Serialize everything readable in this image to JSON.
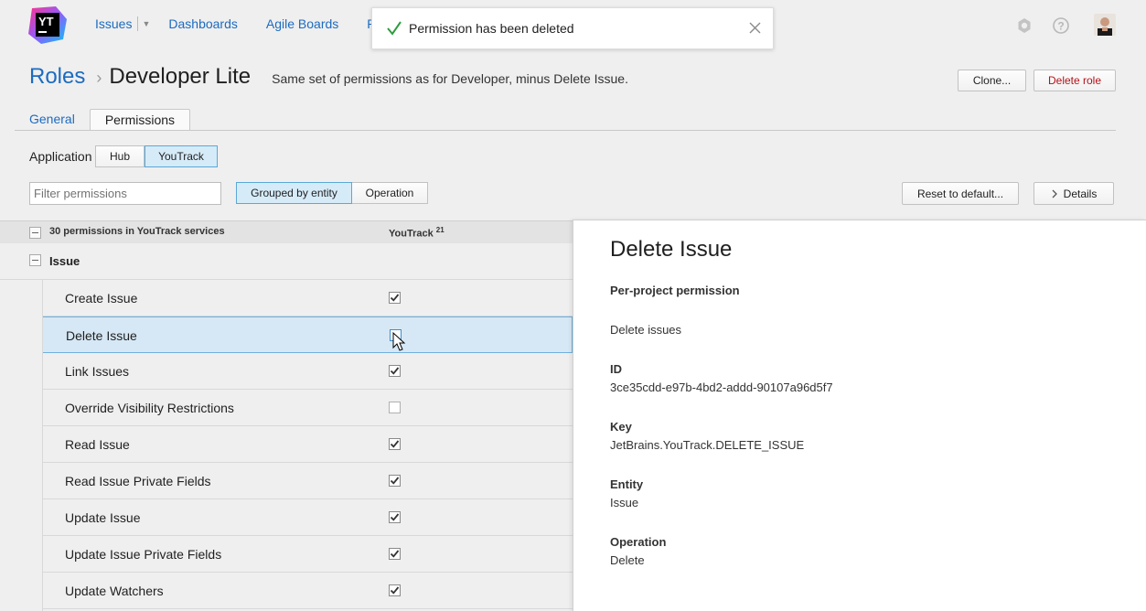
{
  "header": {
    "logo_text": "YT",
    "nav": {
      "issues": "Issues",
      "dashboards": "Dashboards",
      "agile_boards": "Agile Boards",
      "reports_truncated": "Re"
    }
  },
  "toast": {
    "message": "Permission has been deleted"
  },
  "page": {
    "breadcrumb_root": "Roles",
    "breadcrumb_sep": "›",
    "role_name": "Developer Lite",
    "role_description": "Same set of permissions as for Developer, minus Delete Issue.",
    "clone_label": "Clone...",
    "delete_role_label": "Delete role"
  },
  "tabs": [
    {
      "label": "General",
      "active": false
    },
    {
      "label": "Permissions",
      "active": true
    }
  ],
  "application": {
    "label": "Application",
    "options": [
      "Hub",
      "YouTrack"
    ],
    "selected": "YouTrack"
  },
  "filter": {
    "placeholder": "Filter permissions",
    "value": ""
  },
  "grouping": {
    "options": [
      "Grouped by entity",
      "Operation"
    ],
    "selected": "Grouped by entity"
  },
  "actions": {
    "reset_label": "Reset to default...",
    "details_label": "Details"
  },
  "table": {
    "header_title": "30 permissions in YouTrack services",
    "column": "YouTrack",
    "column_count": "21",
    "group": "Issue",
    "rows": [
      {
        "label": "Create Issue",
        "checked": true
      },
      {
        "label": "Delete Issue",
        "checked": false,
        "selected": true
      },
      {
        "label": "Link Issues",
        "checked": true
      },
      {
        "label": "Override Visibility Restrictions",
        "checked": false
      },
      {
        "label": "Read Issue",
        "checked": true
      },
      {
        "label": "Read Issue Private Fields",
        "checked": true
      },
      {
        "label": "Update Issue",
        "checked": true
      },
      {
        "label": "Update Issue Private Fields",
        "checked": true
      },
      {
        "label": "Update Watchers",
        "checked": true
      }
    ]
  },
  "details": {
    "title": "Delete Issue",
    "scope": "Per-project permission",
    "description": "Delete issues",
    "id_label": "ID",
    "id_value": "3ce35cdd-e97b-4bd2-addd-90107a96d5f7",
    "key_label": "Key",
    "key_value": "JetBrains.YouTrack.DELETE_ISSUE",
    "entity_label": "Entity",
    "entity_value": "Issue",
    "operation_label": "Operation",
    "operation_value": "Delete"
  },
  "colors": {
    "link": "#1c6bc0",
    "danger": "#b3111a",
    "selection": "#d6e8f5",
    "check_green": "#2e9c3f"
  }
}
